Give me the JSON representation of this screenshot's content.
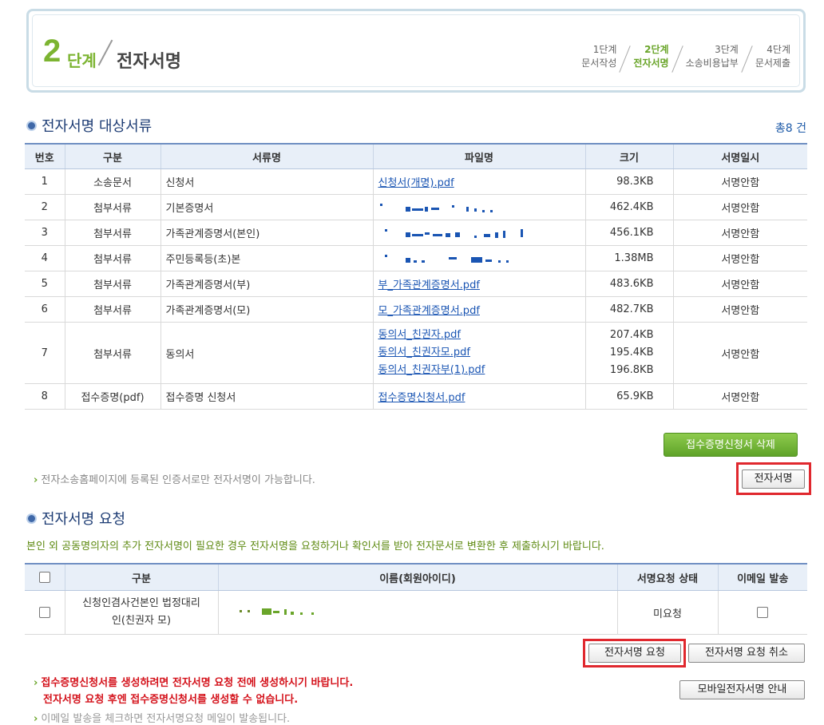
{
  "step_header": {
    "number": "2",
    "word": "단계",
    "title": "전자서명",
    "steps": [
      {
        "line1": "1단계",
        "line2": "문서작성",
        "active": false
      },
      {
        "line1": "2단계",
        "line2": "전자서명",
        "active": true
      },
      {
        "line1": "3단계",
        "line2": "소송비용납부",
        "active": false
      },
      {
        "line1": "4단계",
        "line2": "문서제출",
        "active": false
      }
    ]
  },
  "documents": {
    "section_title": "전자서명 대상서류",
    "total": "총8 건",
    "columns": [
      "번호",
      "구분",
      "서류명",
      "파일명",
      "크기",
      "서명일시"
    ],
    "rows": [
      {
        "no": "1",
        "category": "소송문서",
        "name": "신청서",
        "files": [
          "신청서(개명).pdf"
        ],
        "sizes": [
          "98.3KB"
        ],
        "signed": "서명안함"
      },
      {
        "no": "2",
        "category": "첨부서류",
        "name": "기본증명서",
        "files": [],
        "sizes": [
          "462.4KB"
        ],
        "signed": "서명안함"
      },
      {
        "no": "3",
        "category": "첨부서류",
        "name": "가족관계증명서(본인)",
        "files": [],
        "sizes": [
          "456.1KB"
        ],
        "signed": "서명안함"
      },
      {
        "no": "4",
        "category": "첨부서류",
        "name": "주민등록등(초)본",
        "files": [],
        "sizes": [
          "1.38MB"
        ],
        "signed": "서명안함"
      },
      {
        "no": "5",
        "category": "첨부서류",
        "name": "가족관계증명서(부)",
        "files": [
          "부_가족관계증명서.pdf"
        ],
        "sizes": [
          "483.6KB"
        ],
        "signed": "서명안함"
      },
      {
        "no": "6",
        "category": "첨부서류",
        "name": "가족관계증명서(모)",
        "files": [
          "모_가족관계증명서.pdf"
        ],
        "sizes": [
          "482.7KB"
        ],
        "signed": "서명안함"
      },
      {
        "no": "7",
        "category": "첨부서류",
        "name": "동의서",
        "files": [
          "동의서_친권자.pdf",
          "동의서_친권자모.pdf",
          "동의서_친권자부(1).pdf"
        ],
        "sizes": [
          "207.4KB",
          "195.4KB",
          "196.8KB"
        ],
        "signed": "서명안함"
      },
      {
        "no": "8",
        "category": "접수증명(pdf)",
        "name": "접수증명 신청서",
        "files": [
          "접수증명신청서.pdf"
        ],
        "sizes": [
          "65.9KB"
        ],
        "signed": "서명안함"
      }
    ],
    "delete_button": "접수증명신청서 삭제",
    "note": "전자소송홈페이지에 등록된 인증서로만 전자서명이 가능합니다.",
    "sign_button": "전자서명"
  },
  "request": {
    "section_title": "전자서명 요청",
    "description": "본인 외 공동명의자의 추가 전자서명이 필요한 경우 전자서명을 요청하거나 확인서를 받아 전자문서로 변환한 후 제출하시기 바랍니다.",
    "columns": [
      "구분",
      "이름(회원아이디)",
      "서명요청 상태",
      "이메일 발송"
    ],
    "rows": [
      {
        "category_line1": "신청인겸사건본인 법정대리",
        "category_line2": "인(친권자 모)",
        "status": "미요청"
      }
    ],
    "request_button": "전자서명 요청",
    "cancel_button": "전자서명 요청 취소",
    "mobile_button": "모바일전자서명 안내",
    "warning_line1": "접수증명신청서를 생성하려면 전자서명 요청 전에 생성하시기 바랍니다.",
    "warning_line2": "전자서명 요청 후엔 접수증명신청서를 생성할 수 없습니다.",
    "bottom_note": "이메일 발송을 체크하면 전자서명요청 메일이 발송됩니다."
  },
  "colors": {
    "accent_green": "#7cb431",
    "navy": "#1d3c74",
    "link": "#1a55b3",
    "warning": "#d4121b",
    "highlight": "#e0282e"
  }
}
